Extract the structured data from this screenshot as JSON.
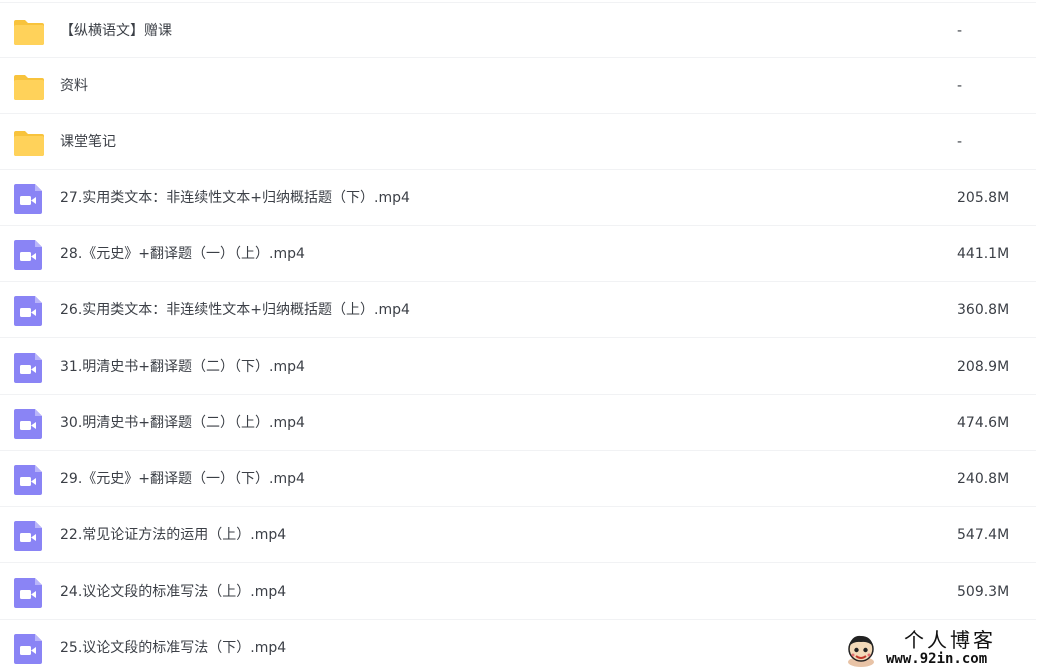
{
  "files": [
    {
      "type": "folder",
      "name": "【纵横语文】赠课",
      "size": "-"
    },
    {
      "type": "folder",
      "name": "资料",
      "size": "-"
    },
    {
      "type": "folder",
      "name": "课堂笔记",
      "size": "-"
    },
    {
      "type": "video",
      "name": "27.实用类文本：非连续性文本+归纳概括题（下）.mp4",
      "size": "205.8M"
    },
    {
      "type": "video",
      "name": "28.《元史》+翻译题（一）（上）.mp4",
      "size": "441.1M"
    },
    {
      "type": "video",
      "name": "26.实用类文本：非连续性文本+归纳概括题（上）.mp4",
      "size": "360.8M"
    },
    {
      "type": "video",
      "name": "31.明清史书+翻译题（二）（下）.mp4",
      "size": "208.9M"
    },
    {
      "type": "video",
      "name": "30.明清史书+翻译题（二）（上）.mp4",
      "size": "474.6M"
    },
    {
      "type": "video",
      "name": "29.《元史》+翻译题（一）（下）.mp4",
      "size": "240.8M"
    },
    {
      "type": "video",
      "name": "22.常见论证方法的运用（上）.mp4",
      "size": "547.4M"
    },
    {
      "type": "video",
      "name": "24.议论文段的标准写法（上）.mp4",
      "size": "509.3M"
    },
    {
      "type": "video",
      "name": "25.议论文段的标准写法（下）.mp4",
      "size": ""
    }
  ],
  "icons": {
    "folder": "folder-icon",
    "video": "video-file-icon"
  },
  "colors": {
    "folder": "#ffd25a",
    "folder_back": "#f8c33c",
    "video": "#8a84f5"
  },
  "watermark": {
    "title": "个人博客",
    "url": "www.92in.com"
  }
}
